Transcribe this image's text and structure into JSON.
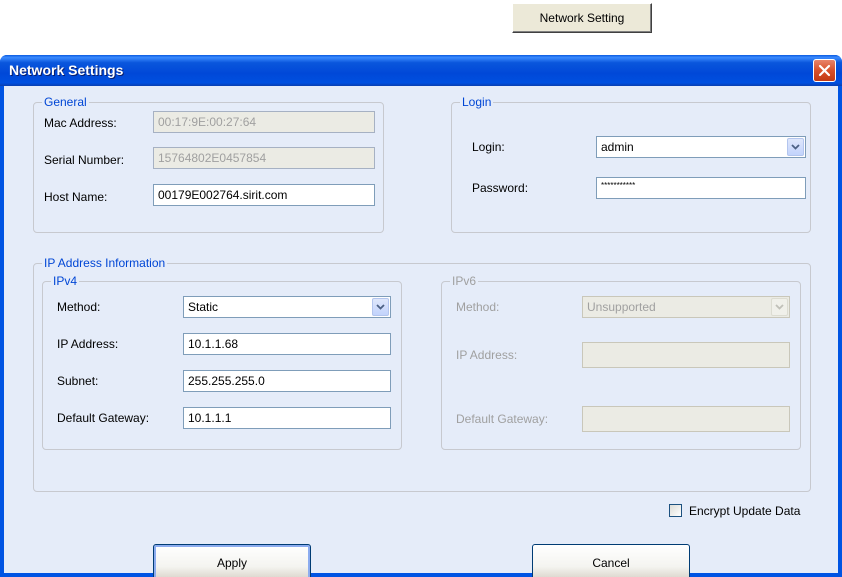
{
  "top_button": {
    "label": "Network Setting"
  },
  "window": {
    "title": "Network Settings"
  },
  "general": {
    "title": "General",
    "mac_label": "Mac Address:",
    "mac_value": "00:17:9E:00:27:64",
    "serial_label": "Serial Number:",
    "serial_value": "15764802E0457854",
    "host_label": "Host Name:",
    "host_value": "00179E002764.sirit.com"
  },
  "login": {
    "title": "Login",
    "login_label": "Login:",
    "login_value": "admin",
    "password_label": "Password:",
    "password_value": "***********"
  },
  "ip_info": {
    "title": "IP Address Information"
  },
  "ipv4": {
    "title": "IPv4",
    "method_label": "Method:",
    "method_value": "Static",
    "ip_label": "IP Address:",
    "ip_value": "10.1.1.68",
    "subnet_label": "Subnet:",
    "subnet_value": "255.255.255.0",
    "gateway_label": "Default Gateway:",
    "gateway_value": "10.1.1.1"
  },
  "ipv6": {
    "title": "IPv6",
    "method_label": "Method:",
    "method_value": "Unsupported",
    "ip_label": "IP Address:",
    "ip_value": "",
    "gateway_label": "Default Gateway:",
    "gateway_value": ""
  },
  "encrypt": {
    "label": "Encrypt Update Data",
    "checked": false
  },
  "buttons": {
    "apply": "Apply",
    "cancel": "Cancel"
  },
  "colors": {
    "titlebar": "#0054e3",
    "client_bg": "#e5ecf9",
    "group_title": "#0046d5",
    "close": "#d9502a"
  },
  "icons": {
    "close": "close-icon",
    "dropdown": "chevron-down-icon"
  }
}
